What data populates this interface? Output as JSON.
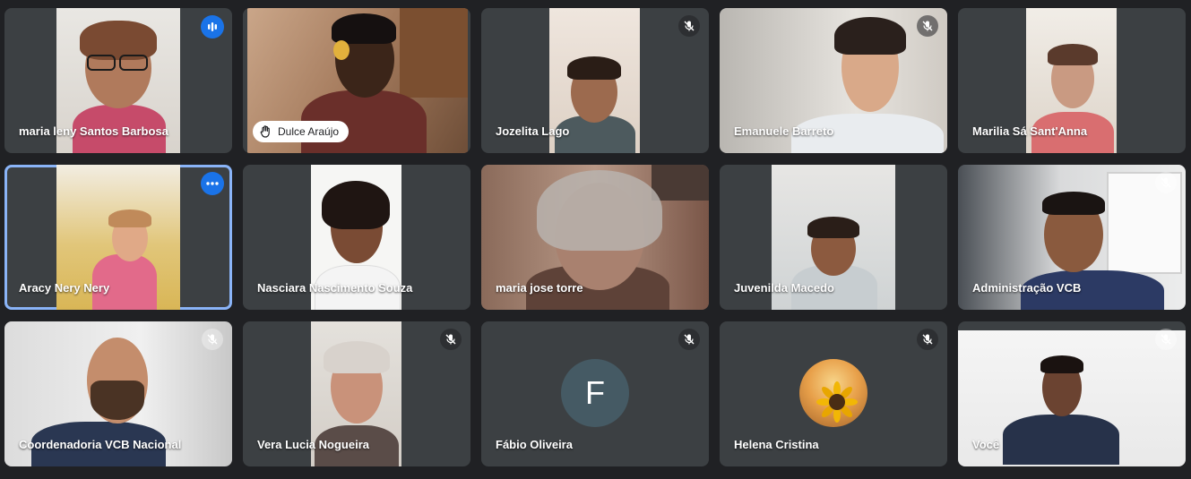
{
  "participants": [
    {
      "name": "maria leny Santos Barbosa",
      "status": "speaking"
    },
    {
      "name": "Dulce Araújo",
      "status": "hand-raised"
    },
    {
      "name": "Jozelita Lago",
      "status": "muted"
    },
    {
      "name": "Emanuele Barreto",
      "status": "muted"
    },
    {
      "name": "Marilia Sá Sant'Anna",
      "status": "none"
    },
    {
      "name": "Aracy Nery Nery",
      "status": "more-options"
    },
    {
      "name": "Nasciara Nascimento Souza",
      "status": "none"
    },
    {
      "name": "maria jose torre",
      "status": "none"
    },
    {
      "name": "Juvenilda Macedo",
      "status": "none"
    },
    {
      "name": "Administração VCB",
      "status": "muted"
    },
    {
      "name": "Coordenadoria VCB Nacional",
      "status": "muted"
    },
    {
      "name": "Vera Lucia Nogueira",
      "status": "muted"
    },
    {
      "name": "Fábio Oliveira",
      "status": "muted",
      "avatar_letter": "F"
    },
    {
      "name": "Helena Cristina",
      "status": "muted"
    },
    {
      "name": "Você",
      "status": "muted"
    }
  ],
  "icons": {
    "muted": "mic-off-icon",
    "speaking": "audio-bars-icon",
    "hand": "raised-hand-icon",
    "more": "more-options-icon"
  },
  "colors": {
    "background": "#202124",
    "tile": "#3c4043",
    "accent": "#1a73e8",
    "active_outline": "#8ab4f8"
  }
}
